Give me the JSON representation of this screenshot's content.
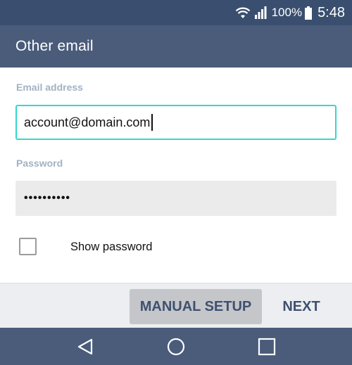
{
  "status_bar": {
    "battery_percent": "100%",
    "time": "5:48",
    "icons": [
      "wifi-icon",
      "signal-icon",
      "battery-icon"
    ]
  },
  "app_bar": {
    "title": "Other email"
  },
  "form": {
    "email_label": "Email address",
    "email_value": "account@domain.com",
    "password_label": "Password",
    "password_masked": "••••••••••",
    "show_password_label": "Show password",
    "show_password_checked": false
  },
  "actions": {
    "manual_setup_label": "MANUAL SETUP",
    "next_label": "NEXT"
  },
  "nav_bar": {
    "icons": [
      "back-icon",
      "home-icon",
      "recents-icon"
    ]
  },
  "colors": {
    "status_bar": "#3a4f6f",
    "app_bar": "#4a5c7a",
    "accent_focus": "#35d6d0",
    "label": "#a2b2c4",
    "button_text": "#3f5070"
  }
}
